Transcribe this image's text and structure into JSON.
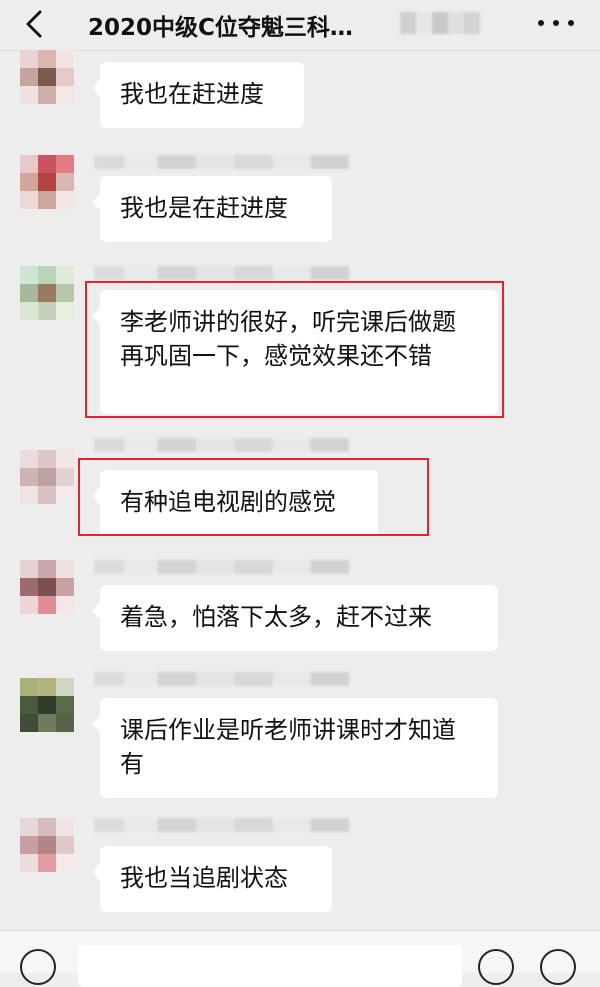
{
  "header": {
    "title": "2020中级C位夺魁三科…",
    "back_icon": "chevron-left-icon",
    "more_icon": "more-dots-icon"
  },
  "messages": [
    {
      "text": "我也在赶进度",
      "avatar_colors": [
        "#e9d3d3",
        "#d9b7b0",
        "#f1e4e2",
        "#c7a59f",
        "#7c5a4e",
        "#e4cbc7",
        "#efe1df",
        "#cfb0a8",
        "#f3e8e6"
      ]
    },
    {
      "text": "我也是在赶进度",
      "avatar_colors": [
        "#e7c9cc",
        "#c9535e",
        "#e47a84",
        "#d4a59d",
        "#b5463f",
        "#d9b7b2",
        "#ecd8d4",
        "#caa8a0",
        "#f2e5e3"
      ]
    },
    {
      "text": "李老师讲的很好，听完课后做题再巩固一下，感觉效果还不错",
      "avatar_colors": [
        "#cfe6d5",
        "#b9d5b8",
        "#dcebd8",
        "#a8b99a",
        "#9a7a5c",
        "#b7c6a7",
        "#d9e6d1",
        "#c5d2bb",
        "#e6efe0"
      ]
    },
    {
      "text": "有种追电视剧的感觉",
      "avatar_colors": [
        "#eadcdc",
        "#dcc7c6",
        "#f1e6e6",
        "#cdb4b3",
        "#bca2a1",
        "#e2d1d0",
        "#eee4e4",
        "#d6c1c0",
        "#f3ebeb"
      ]
    },
    {
      "text": "着急，怕落下太多，赶不过来",
      "avatar_colors": [
        "#e6d2d3",
        "#c9a7a8",
        "#efe0e0",
        "#9d6b6b",
        "#7d4f4e",
        "#caa1a2",
        "#ebd7d8",
        "#e08d95",
        "#f5e7e8"
      ]
    },
    {
      "text": "课后作业是听老师讲课时才知道有",
      "avatar_colors": [
        "#a9b07c",
        "#b3b47e",
        "#cfd7c4",
        "#4a5b3c",
        "#2f3d2a",
        "#5b6b49",
        "#3e4d36",
        "#6f7a5a",
        "#56624a"
      ]
    },
    {
      "text": "我也当追剧状态",
      "avatar_colors": [
        "#e8d7d8",
        "#d6bcbd",
        "#f0e5e5",
        "#c89ea0",
        "#b28586",
        "#e0c8c9",
        "#ecdcdd",
        "#e49aa2",
        "#f5e9ea"
      ]
    }
  ],
  "input": {
    "placeholder": ""
  },
  "footer": {
    "voice_icon": "voice-icon",
    "emoji_icon": "emoji-icon",
    "plus_icon": "plus-icon"
  },
  "colors": {
    "background": "#ededed",
    "bubble": "#ffffff",
    "highlight": "#e0262a"
  }
}
